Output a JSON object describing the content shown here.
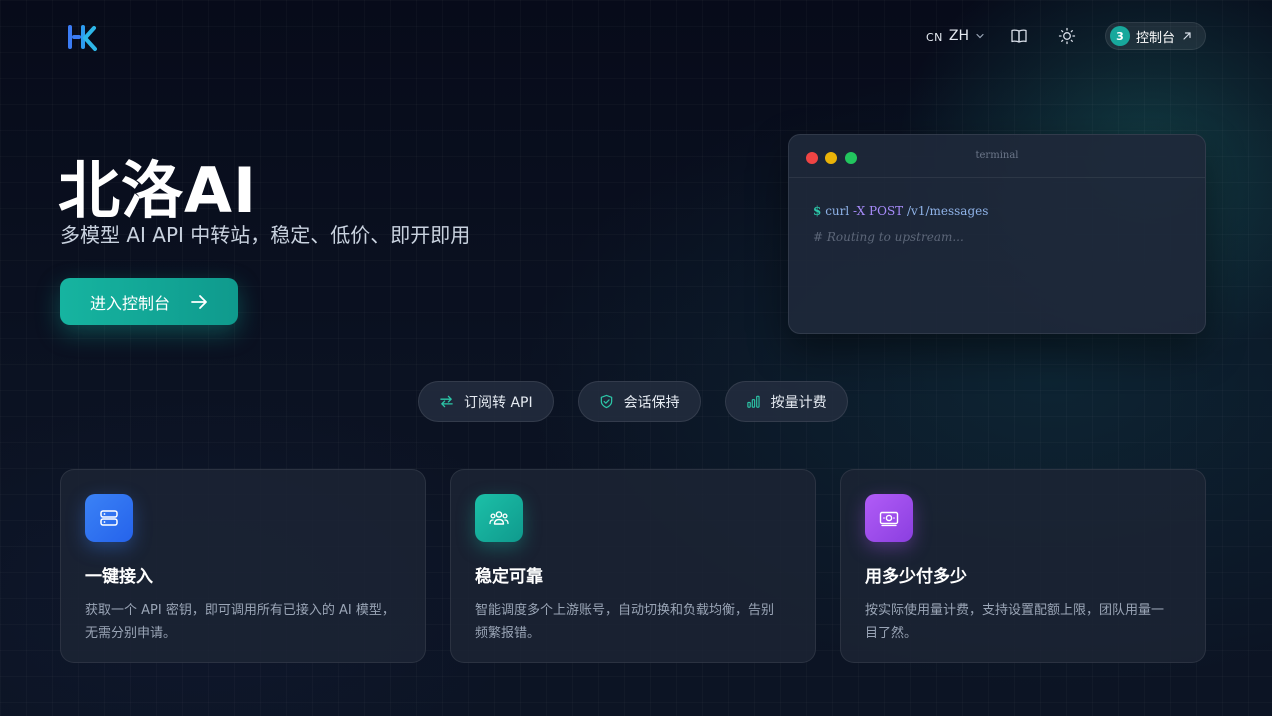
{
  "header": {
    "lang_code": "CN",
    "lang_label": "ZH",
    "console_badge": "3",
    "console_label": "控制台"
  },
  "hero": {
    "title": "北洛AI",
    "subtitle": "多模型 AI API 中转站，稳定、低价、即开即用",
    "cta_label": "进入控制台"
  },
  "terminal": {
    "title": "terminal",
    "prompt": "$",
    "command": "curl",
    "flag": "-X POST",
    "path": "/v1/messages",
    "comment": "# Routing to upstream..."
  },
  "chips": [
    {
      "label": "订阅转 API",
      "icon": "swap-arrows-icon"
    },
    {
      "label": "会话保持",
      "icon": "shield-check-icon"
    },
    {
      "label": "按量计费",
      "icon": "bar-chart-icon"
    }
  ],
  "cards": [
    {
      "title": "一键接入",
      "desc": "获取一个 API 密钥，即可调用所有已接入的 AI 模型，无需分别申请。",
      "icon": "server-icon",
      "color": "#3b7cf5"
    },
    {
      "title": "稳定可靠",
      "desc": "智能调度多个上游账号，自动切换和负载均衡，告别频繁报错。",
      "icon": "users-icon",
      "color": "#16b4a0"
    },
    {
      "title": "用多少付多少",
      "desc": "按实际使用量计费，支持设置配额上限，团队用量一目了然。",
      "icon": "money-icon",
      "color": "#a855f7"
    }
  ],
  "colors": {
    "accent": "#16b4a0",
    "brand_blue": "#3b7cf5",
    "purple": "#a855f7",
    "mac_red": "#ef4444",
    "mac_yellow": "#eab308",
    "mac_green": "#22c55e"
  }
}
